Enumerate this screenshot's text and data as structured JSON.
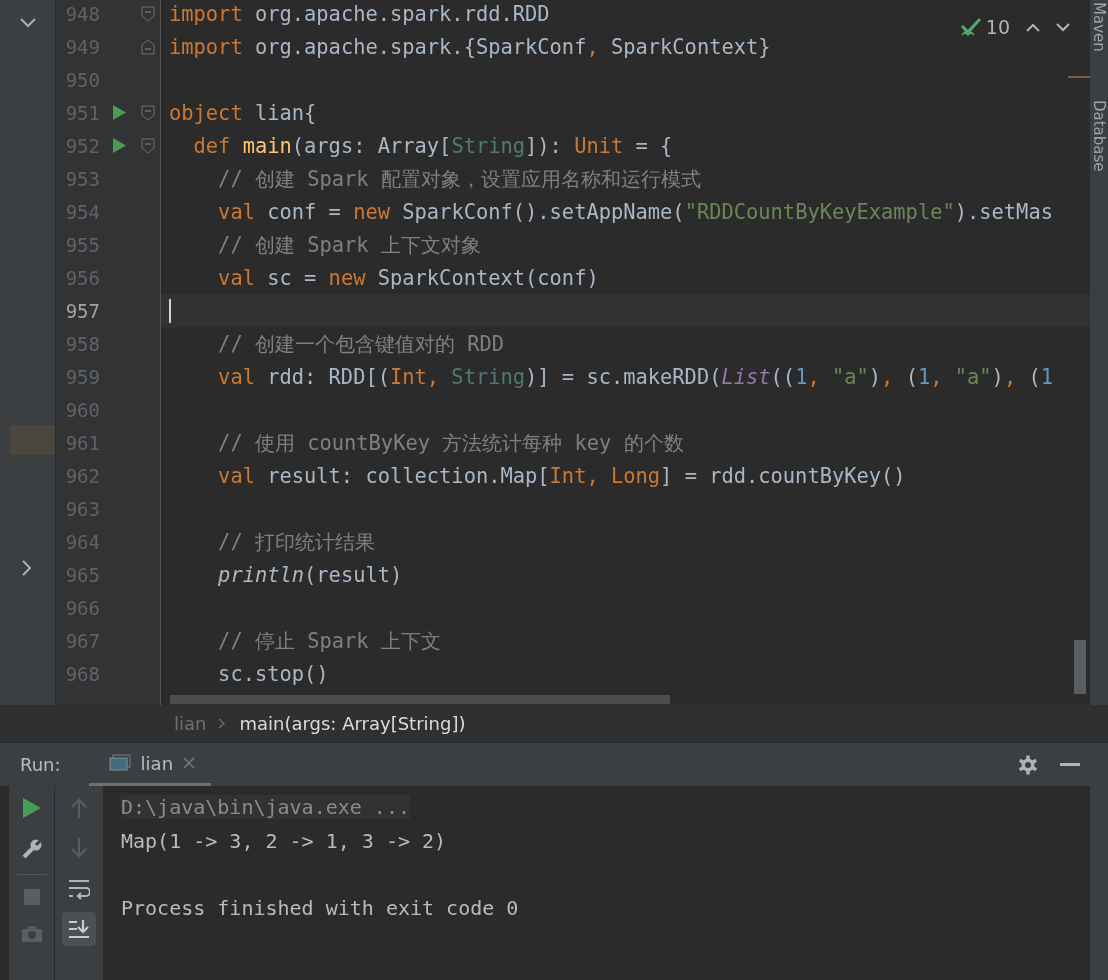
{
  "editor": {
    "lines": [
      {
        "number": "948",
        "run": false,
        "fold_start": true,
        "fold_end": false,
        "current": false,
        "tokens": [
          {
            "kind": "kw",
            "text": "import"
          },
          {
            "kind": "plain",
            "text": " org.apache.spark.rdd.RDD"
          }
        ]
      },
      {
        "number": "949",
        "run": false,
        "fold_start": false,
        "fold_end": true,
        "current": false,
        "tokens": [
          {
            "kind": "kw",
            "text": "import"
          },
          {
            "kind": "plain",
            "text": " org.apache.spark.{SparkConf"
          },
          {
            "kind": "kw",
            "text": ","
          },
          {
            "kind": "plain",
            "text": " SparkContext}"
          }
        ]
      },
      {
        "number": "950",
        "run": false,
        "fold_start": false,
        "fold_end": false,
        "current": false
      },
      {
        "number": "951",
        "run": true,
        "fold_start": true,
        "fold_end": false,
        "current": false,
        "tokens": [
          {
            "kind": "kw",
            "text": "object"
          },
          {
            "kind": "plain",
            "text": " lian{"
          }
        ]
      },
      {
        "number": "952",
        "run": true,
        "fold_start": true,
        "fold_end": false,
        "current": false,
        "tokens": [
          {
            "kind": "kw",
            "text": "  def"
          },
          {
            "kind": "fn",
            "text": " main"
          },
          {
            "kind": "plain",
            "text": "(args: Array["
          },
          {
            "kind": "type",
            "text": "String"
          },
          {
            "kind": "plain",
            "text": "]): "
          },
          {
            "kind": "kw",
            "text": "Unit"
          },
          {
            "kind": "plain",
            "text": " = {"
          }
        ]
      },
      {
        "number": "953",
        "run": false,
        "fold_start": false,
        "fold_end": false,
        "current": false,
        "tokens": [
          {
            "kind": "comment",
            "text": "    // 创建 Spark 配置对象，设置应用名称和运行模式"
          }
        ]
      },
      {
        "number": "954",
        "run": false,
        "fold_start": false,
        "fold_end": false,
        "current": false,
        "tokens": [
          {
            "kind": "kw",
            "text": "    val"
          },
          {
            "kind": "plain",
            "text": " conf = "
          },
          {
            "kind": "kw",
            "text": "new"
          },
          {
            "kind": "plain",
            "text": " SparkConf().setAppName("
          },
          {
            "kind": "str",
            "text": "\"RDDCountByKeyExample\""
          },
          {
            "kind": "plain",
            "text": ").setMas"
          }
        ]
      },
      {
        "number": "955",
        "run": false,
        "fold_start": false,
        "fold_end": false,
        "current": false,
        "tokens": [
          {
            "kind": "comment",
            "text": "    // 创建 Spark 上下文对象"
          }
        ]
      },
      {
        "number": "956",
        "run": false,
        "fold_start": false,
        "fold_end": false,
        "current": false,
        "tokens": [
          {
            "kind": "kw",
            "text": "    val"
          },
          {
            "kind": "plain",
            "text": " sc = "
          },
          {
            "kind": "kw",
            "text": "new"
          },
          {
            "kind": "plain",
            "text": " SparkContext(conf)"
          }
        ]
      },
      {
        "number": "957",
        "run": false,
        "fold_start": false,
        "fold_end": false,
        "current": true
      },
      {
        "number": "958",
        "run": false,
        "fold_start": false,
        "fold_end": false,
        "current": false,
        "tokens": [
          {
            "kind": "comment",
            "text": "    // 创建一个包含键值对的 RDD"
          }
        ]
      },
      {
        "number": "959",
        "run": false,
        "fold_start": false,
        "fold_end": false,
        "current": false,
        "tokens": [
          {
            "kind": "kw",
            "text": "    val"
          },
          {
            "kind": "plain",
            "text": " rdd: RDD[("
          },
          {
            "kind": "kw",
            "text": "Int,"
          },
          {
            "kind": "type",
            "text": " String"
          },
          {
            "kind": "plain",
            "text": ")] = sc.makeRDD("
          },
          {
            "kind": "call",
            "text": "List"
          },
          {
            "kind": "plain",
            "text": "(("
          },
          {
            "kind": "num",
            "text": "1"
          },
          {
            "kind": "kw",
            "text": ","
          },
          {
            "kind": "str",
            "text": " \"a\""
          },
          {
            "kind": "plain",
            "text": ")"
          },
          {
            "kind": "kw",
            "text": ","
          },
          {
            "kind": "plain",
            "text": " ("
          },
          {
            "kind": "num",
            "text": "1"
          },
          {
            "kind": "kw",
            "text": ","
          },
          {
            "kind": "str",
            "text": " \"a\""
          },
          {
            "kind": "plain",
            "text": ")"
          },
          {
            "kind": "kw",
            "text": ","
          },
          {
            "kind": "plain",
            "text": " ("
          },
          {
            "kind": "num",
            "text": "1"
          }
        ]
      },
      {
        "number": "960",
        "run": false,
        "fold_start": false,
        "fold_end": false,
        "current": false
      },
      {
        "number": "961",
        "run": false,
        "fold_start": false,
        "fold_end": false,
        "current": false,
        "tokens": [
          {
            "kind": "comment",
            "text": "    // 使用 countByKey 方法统计每种 key 的个数"
          }
        ]
      },
      {
        "number": "962",
        "run": false,
        "fold_start": false,
        "fold_end": false,
        "current": false,
        "tokens": [
          {
            "kind": "kw",
            "text": "    val"
          },
          {
            "kind": "plain",
            "text": " result: collection.Map["
          },
          {
            "kind": "kw",
            "text": "Int, Long"
          },
          {
            "kind": "plain",
            "text": "] = rdd.countByKey()"
          }
        ]
      },
      {
        "number": "963",
        "run": false,
        "fold_start": false,
        "fold_end": false,
        "current": false
      },
      {
        "number": "964",
        "run": false,
        "fold_start": false,
        "fold_end": false,
        "current": false,
        "tokens": [
          {
            "kind": "comment",
            "text": "    // 打印统计结果"
          }
        ]
      },
      {
        "number": "965",
        "run": false,
        "fold_start": false,
        "fold_end": false,
        "current": false,
        "tokens": [
          {
            "kind": "italic",
            "text": "    println"
          },
          {
            "kind": "plain",
            "text": "(result)"
          }
        ]
      },
      {
        "number": "966",
        "run": false,
        "fold_start": false,
        "fold_end": false,
        "current": false
      },
      {
        "number": "967",
        "run": false,
        "fold_start": false,
        "fold_end": false,
        "current": false,
        "tokens": [
          {
            "kind": "comment",
            "text": "    // 停止 Spark 上下文"
          }
        ]
      },
      {
        "number": "968",
        "run": false,
        "fold_start": false,
        "fold_end": false,
        "current": false,
        "tokens": [
          {
            "kind": "plain",
            "text": "    sc.stop()"
          }
        ]
      }
    ]
  },
  "inspection": {
    "count": "10"
  },
  "side_tabs": [
    "Maven",
    "Database"
  ],
  "breadcrumb": [
    "lian",
    "main(args: Array[String])"
  ],
  "run_panel": {
    "label": "Run:",
    "tabs": [
      {
        "label": "lian",
        "selected": true
      }
    ],
    "output": [
      {
        "kind": "command",
        "text": "D:\\java\\bin\\java.exe ..."
      },
      {
        "kind": "plain",
        "text": "Map(1 -> 3, 2 -> 1, 3 -> 2)"
      },
      {
        "kind": "status",
        "text": "Process finished with exit code 0"
      }
    ]
  }
}
